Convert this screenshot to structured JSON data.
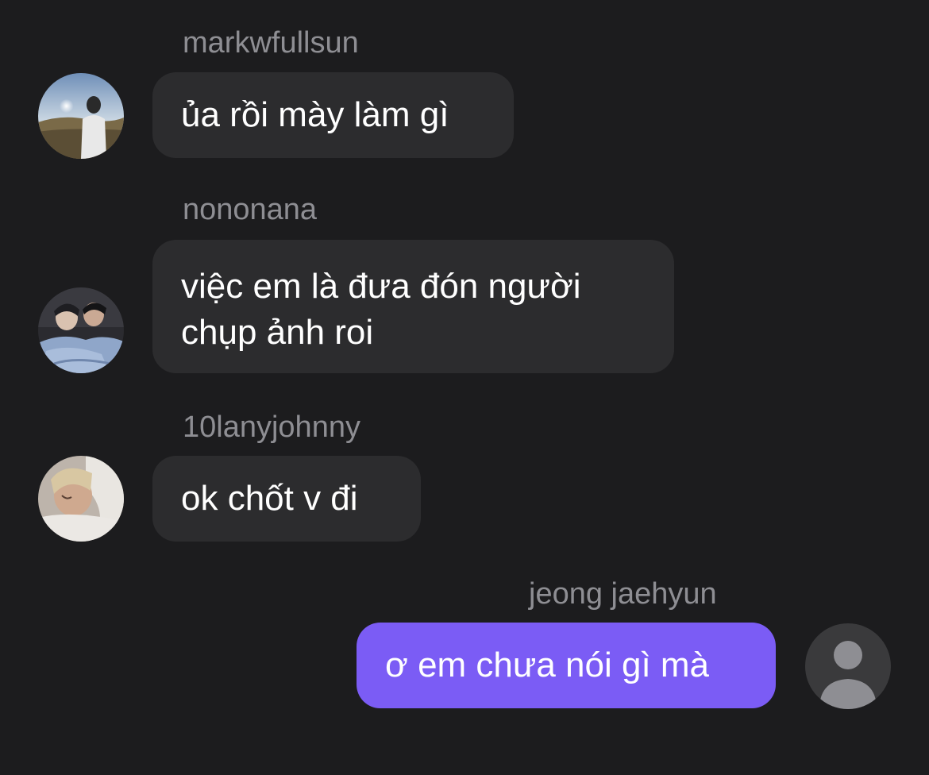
{
  "messages": [
    {
      "sender": "markwfullsun",
      "lines": [
        "ủa rồi mày làm gì"
      ],
      "avatar_icon": "user-photo-icon"
    },
    {
      "sender": "nononana",
      "lines": [
        "việc em là đưa đón người",
        "chụp ảnh roi"
      ],
      "avatar_icon": "user-photo-icon"
    },
    {
      "sender": "10lanyjohnny",
      "lines": [
        "ok chốt v đi"
      ],
      "avatar_icon": "user-photo-icon"
    },
    {
      "sender": "jeong jaehyun",
      "lines": [
        "ơ em chưa nói gì mà"
      ],
      "avatar_icon": "default-user-icon"
    }
  ],
  "colors": {
    "background": "#1c1c1e",
    "incoming_bubble": "#2c2c2e",
    "outgoing_bubble": "#7b5cf5",
    "sender_text": "#8e8e93",
    "message_text": "#ffffff"
  }
}
